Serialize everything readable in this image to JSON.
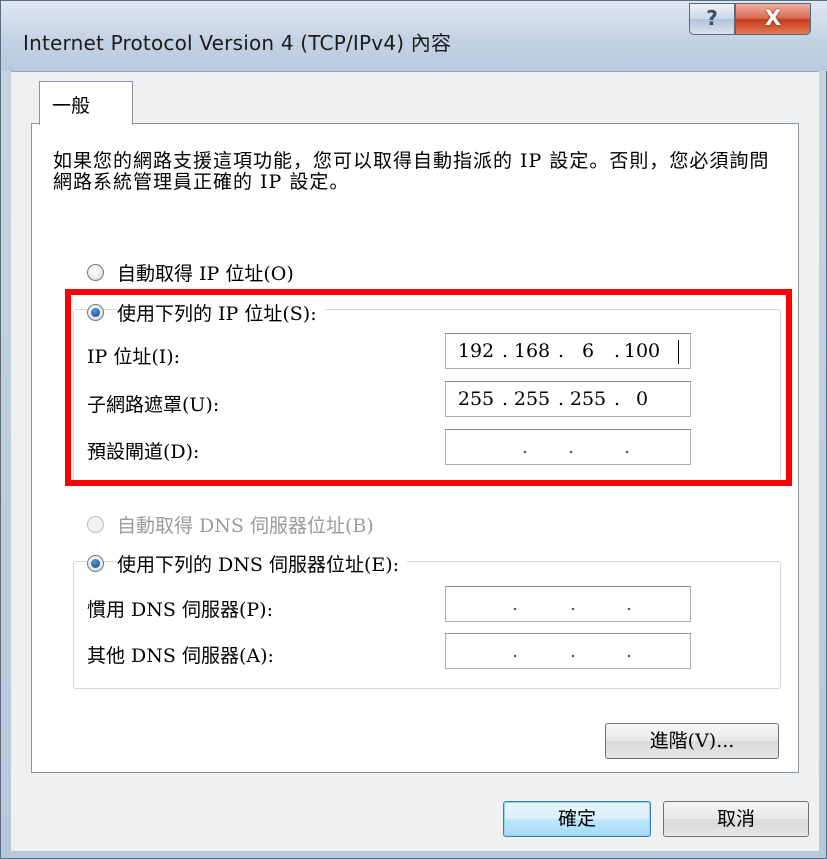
{
  "window": {
    "title": "Internet Protocol Version 4 (TCP/IPv4) 內容",
    "help_glyph": "?",
    "close_glyph": "X"
  },
  "tabs": [
    {
      "label": "一般",
      "selected": true
    }
  ],
  "intro_text": "如果您的網路支援這項功能，您可以取得自動指派的 IP 設定。否則，您必須詢問網路系統管理員正確的 IP 設定。",
  "ip_mode": {
    "auto_label": "自動取得 IP 位址(O)",
    "manual_label": "使用下列的 IP 位址(S):",
    "selected": "manual"
  },
  "ip_fields": {
    "ip_address": {
      "label": "IP 位址(I):",
      "octets": [
        "192",
        "168",
        "6",
        "100"
      ]
    },
    "subnet_mask": {
      "label": "子網路遮罩(U):",
      "octets": [
        "255",
        "255",
        "255",
        "0"
      ]
    },
    "default_gateway": {
      "label": "預設閘道(D):",
      "octets": [
        "",
        "",
        "",
        ""
      ]
    }
  },
  "dns_mode": {
    "auto_label": "自動取得 DNS 伺服器位址(B)",
    "manual_label": "使用下列的 DNS 伺服器位址(E):",
    "selected": "manual",
    "auto_enabled": false
  },
  "dns_fields": {
    "preferred": {
      "label": "慣用 DNS 伺服器(P):",
      "octets": [
        "",
        "",
        "",
        ""
      ]
    },
    "alternate": {
      "label": "其他 DNS 伺服器(A):",
      "octets": [
        "",
        "",
        "",
        ""
      ]
    }
  },
  "buttons": {
    "advanced": "進階(V)...",
    "ok": "確定",
    "cancel": "取消"
  },
  "annotation": {
    "highlight_color": "#ff0000"
  }
}
